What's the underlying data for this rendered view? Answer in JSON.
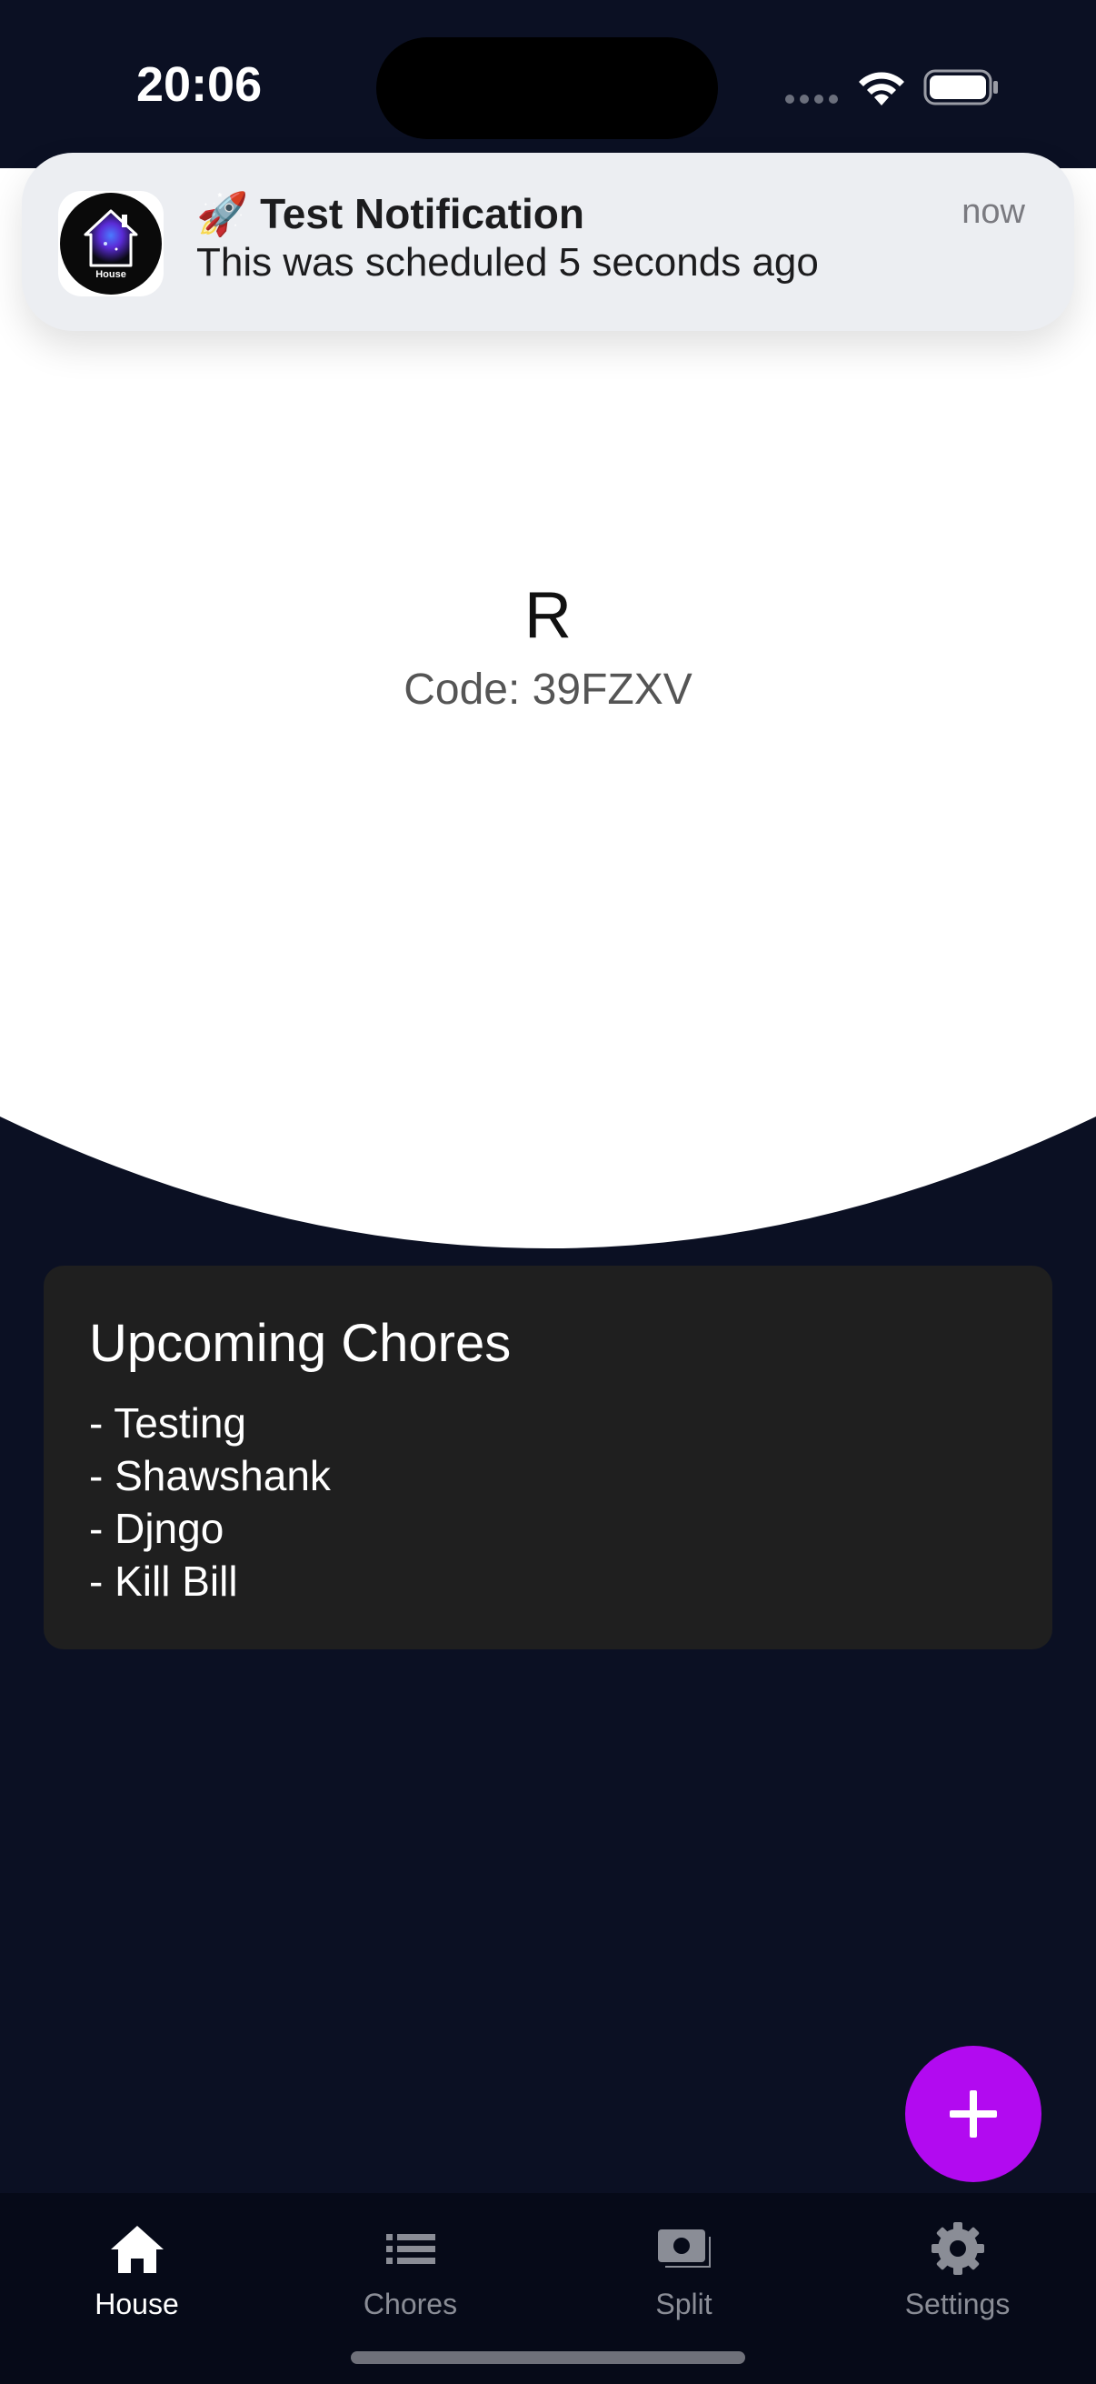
{
  "status_bar": {
    "time": "20:06",
    "icons": [
      "signal-dots-icon",
      "wifi-icon",
      "battery-icon"
    ]
  },
  "notification": {
    "app_icon_label": "House",
    "title_emoji": "🚀",
    "title": "Test Notification",
    "body": "This was scheduled 5 seconds ago",
    "time": "now"
  },
  "house": {
    "name": "R",
    "code": "Code: 39FZXV"
  },
  "upcoming_chores": {
    "title": "Upcoming Chores",
    "items": [
      "- Testing",
      "- Shawshank",
      "- Djngo",
      "- Kill Bill"
    ]
  },
  "fab": {
    "icon": "plus-icon"
  },
  "bottom_nav": {
    "items": [
      {
        "label": "House",
        "icon": "home-icon",
        "active": true
      },
      {
        "label": "Chores",
        "icon": "list-icon",
        "active": false
      },
      {
        "label": "Split",
        "icon": "money-icon",
        "active": false
      },
      {
        "label": "Settings",
        "icon": "gear-icon",
        "active": false
      }
    ]
  },
  "colors": {
    "background": "#0b1023",
    "card": "#1f1f1f",
    "accent": "#b20af0",
    "nav_background": "#060a18"
  }
}
